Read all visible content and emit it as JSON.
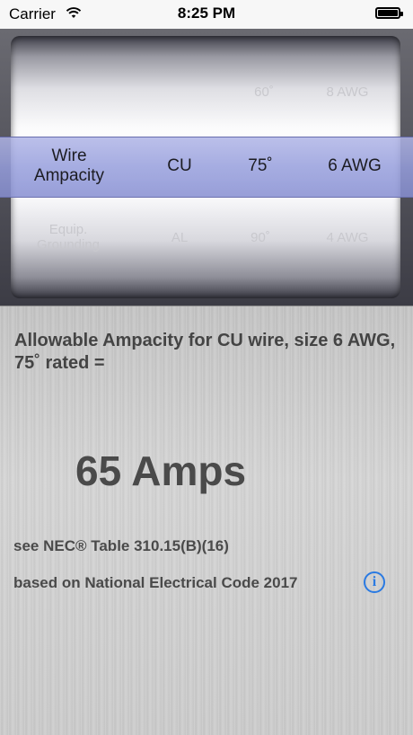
{
  "status_bar": {
    "carrier": "Carrier",
    "time": "8:25 PM"
  },
  "picker": {
    "rows": {
      "above": {
        "conductor": "",
        "temp": "60˚",
        "size": "8 AWG"
      },
      "selected": {
        "type_line1": "Wire",
        "type_line2": "Ampacity",
        "conductor": "CU",
        "temp": "75˚",
        "size": "6 AWG"
      },
      "below": {
        "type_line1": "Equip.",
        "type_line2": "Grounding",
        "conductor": "AL",
        "temp": "90˚",
        "size": "4 AWG"
      }
    }
  },
  "result": {
    "headline": "Allowable Ampacity for CU wire, size 6 AWG, 75˚ rated =",
    "value": "65 Amps",
    "reference": "see NEC® Table 310.15(B)(16)",
    "based_on": "based on National Electrical Code 2017"
  },
  "colors": {
    "accent": "#2a7ae2",
    "selection": "#9aa0dc"
  },
  "icons": {
    "wifi": "wifi-icon",
    "battery": "battery-icon",
    "info": "info-icon"
  }
}
